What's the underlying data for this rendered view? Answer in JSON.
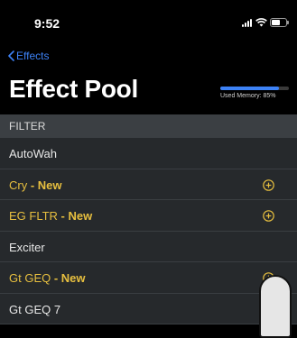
{
  "status_bar": {
    "time": "9:52"
  },
  "nav": {
    "back_label": "Effects"
  },
  "header": {
    "title": "Effect Pool"
  },
  "memory": {
    "label": "Used Memory: 85%",
    "fraction": 0.85
  },
  "filter": {
    "label": "FILTER"
  },
  "effects": [
    {
      "name": "AutoWah",
      "tag": "",
      "is_new": false
    },
    {
      "name": "Cry",
      "tag": " - New",
      "is_new": true
    },
    {
      "name": "EG FLTR",
      "tag": " - New",
      "is_new": true
    },
    {
      "name": "Exciter",
      "tag": "",
      "is_new": false
    },
    {
      "name": "Gt GEQ",
      "tag": " - New",
      "is_new": true
    },
    {
      "name": "Gt GEQ 7",
      "tag": "",
      "is_new": false
    }
  ],
  "colors": {
    "accent": "#3d82f6",
    "new": "#e7bf3f",
    "row_bg": "#26292c",
    "section_bg": "#3b3f43"
  },
  "icons": {
    "add": "plus-circle-icon",
    "back": "chevron-left-icon"
  }
}
